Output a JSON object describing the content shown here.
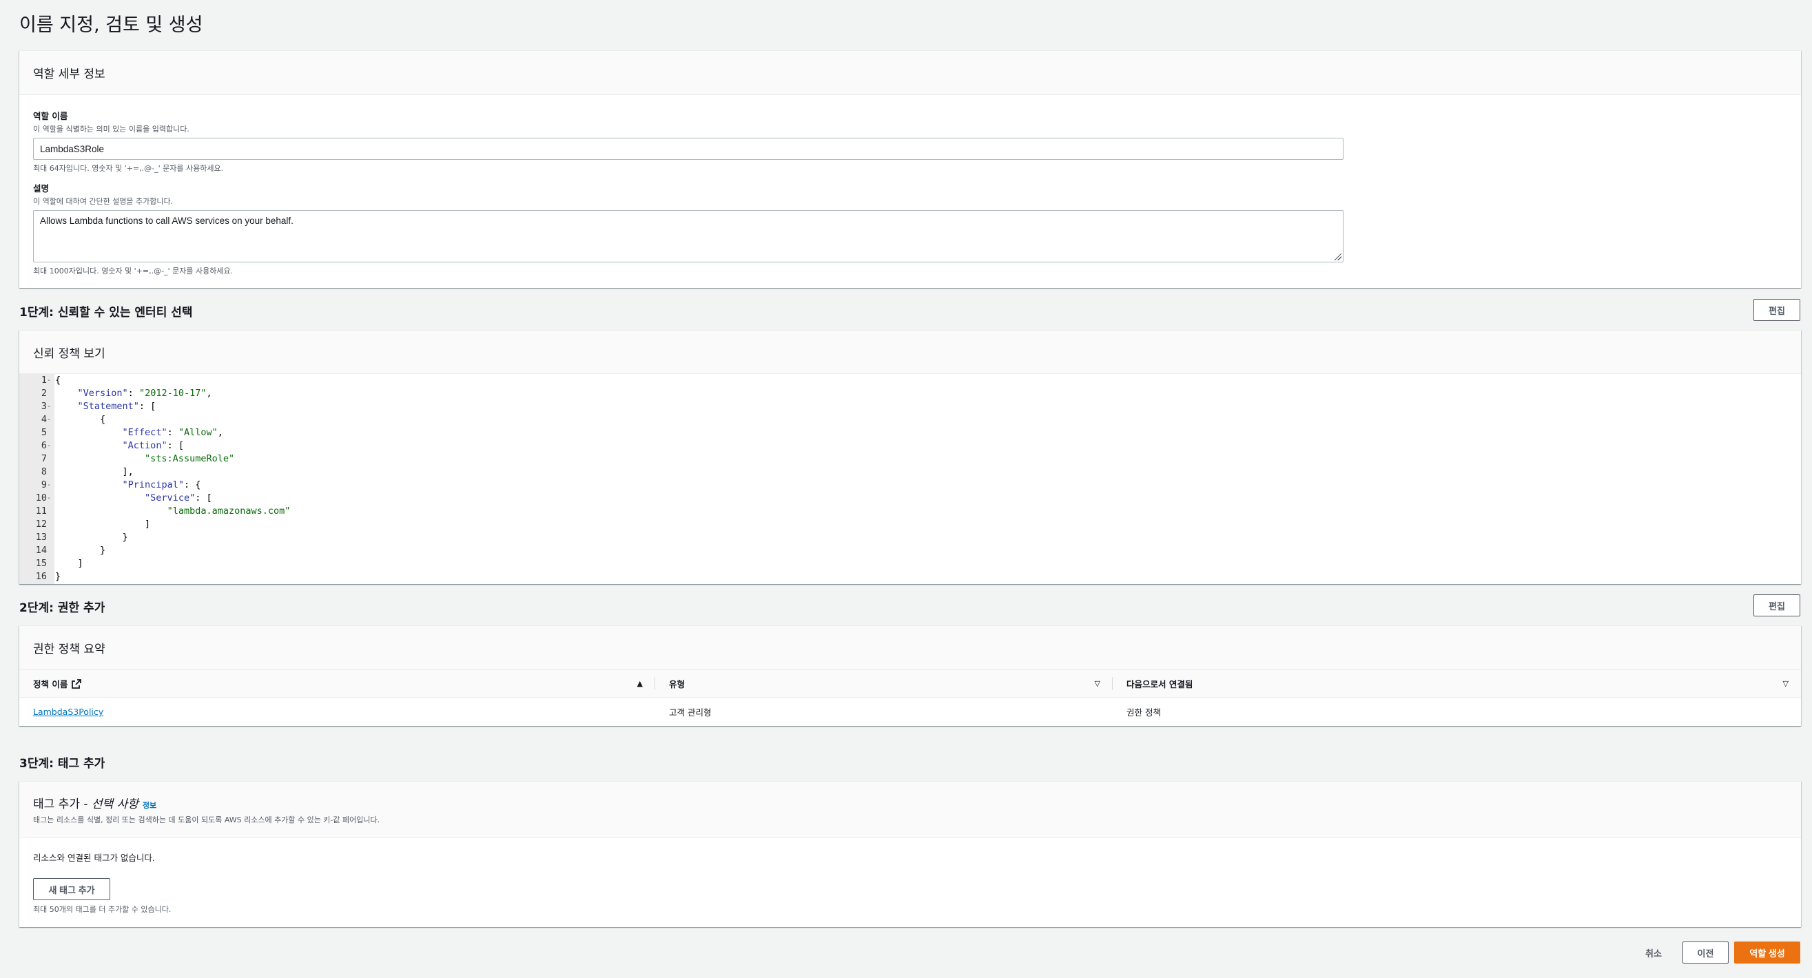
{
  "page": {
    "title": "이름 지정, 검토 및 생성"
  },
  "role_details": {
    "header": "역할 세부 정보",
    "name_label": "역할 이름",
    "name_desc": "이 역할을 식별하는 의미 있는 이름을 입력합니다.",
    "name_value": "LambdaS3Role",
    "name_hint": "최대 64자입니다. 영숫자 및 '+=,.@-_' 문자를 사용하세요.",
    "desc_label": "설명",
    "desc_desc": "이 역할에 대하여 간단한 설명을 추가합니다.",
    "desc_value": "Allows Lambda functions to call AWS services on your behalf.",
    "desc_hint": "최대 1000자입니다. 영숫자 및 '+=,.@-_' 문자를 사용하세요."
  },
  "step1": {
    "title": "1단계: 신뢰할 수 있는 엔터티 선택",
    "edit_label": "편집",
    "card_header": "신뢰 정책 보기",
    "lines": [
      {
        "n": "1",
        "fold": "-",
        "text": "{"
      },
      {
        "n": "2",
        "fold": "",
        "text": "    \"Version\": \"2012-10-17\","
      },
      {
        "n": "3",
        "fold": "-",
        "text": "    \"Statement\": ["
      },
      {
        "n": "4",
        "fold": "-",
        "text": "        {"
      },
      {
        "n": "5",
        "fold": "",
        "text": "            \"Effect\": \"Allow\","
      },
      {
        "n": "6",
        "fold": "-",
        "text": "            \"Action\": ["
      },
      {
        "n": "7",
        "fold": "",
        "text": "                \"sts:AssumeRole\""
      },
      {
        "n": "8",
        "fold": "",
        "text": "            ],"
      },
      {
        "n": "9",
        "fold": "-",
        "text": "            \"Principal\": {"
      },
      {
        "n": "10",
        "fold": "-",
        "text": "                \"Service\": ["
      },
      {
        "n": "11",
        "fold": "",
        "text": "                    \"lambda.amazonaws.com\""
      },
      {
        "n": "12",
        "fold": "",
        "text": "                ]"
      },
      {
        "n": "13",
        "fold": "",
        "text": "            }"
      },
      {
        "n": "14",
        "fold": "",
        "text": "        }"
      },
      {
        "n": "15",
        "fold": "",
        "text": "    ]"
      },
      {
        "n": "16",
        "fold": "",
        "text": "}"
      }
    ]
  },
  "step2": {
    "title": "2단계: 권한 추가",
    "edit_label": "편집",
    "card_header": "권한 정책 요약",
    "columns": [
      "정책 이름",
      "유형",
      "다음으로서 연결됨"
    ],
    "rows": [
      {
        "policy": "LambdaS3Policy",
        "type": "고객 관리형",
        "attached_as": "권한 정책"
      }
    ]
  },
  "step3": {
    "title": "3단계: 태그 추가",
    "card_header_prefix": "태그 추가 - ",
    "card_header_optional": "선택 사항",
    "info_link": "정보",
    "card_desc": "태그는 리소스를 식별, 정리 또는 검색하는 데 도움이 되도록 AWS 리소스에 추가할 수 있는 키-값 페어입니다.",
    "empty_text": "리소스와 연결된 태그가 없습니다.",
    "add_tag_label": "새 태그 추가",
    "limit_hint": "최대 50개의 태그를 더 추가할 수 있습니다."
  },
  "footer": {
    "cancel_label": "취소",
    "prev_label": "이전",
    "create_label": "역할 생성"
  }
}
